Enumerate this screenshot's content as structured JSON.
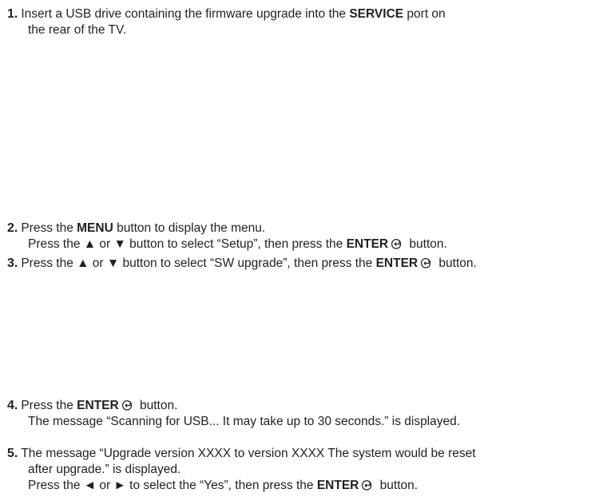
{
  "steps": [
    {
      "number": "1.",
      "line1_a": "Insert a USB drive containing the firmware upgrade into the ",
      "line1_bold": "SERVICE",
      "line1_b": " port on",
      "line2": "the rear of the TV."
    },
    {
      "number": "2.",
      "line1_a": "Press the ",
      "line1_bold": "MENU",
      "line1_b": " button to display the menu.",
      "line2_a": "Press the ▲ or ▼ button to select “Setup”, then press the ",
      "line2_bold": "ENTER",
      "line2_b": " button."
    },
    {
      "number": "3.",
      "line1_a": "Press the ▲ or ▼ button to select “SW upgrade”, then press the ",
      "line1_bold": "ENTER",
      "line1_b": " button."
    },
    {
      "number": "4.",
      "line1_a": "Press the ",
      "line1_bold": "ENTER",
      "line1_b": " button.",
      "line2": "The message “Scanning for USB... It may take up to 30 seconds.” is displayed."
    },
    {
      "number": "5.",
      "line1": "The message “Upgrade version XXXX to version XXXX The system would be reset",
      "line2": "after upgrade.” is displayed.",
      "line3_a": "Press the ◄ or ► to select the “Yes”, then press the ",
      "line3_bold": "ENTER",
      "line3_b": " button."
    }
  ],
  "icons": {
    "enter": "enter-icon"
  }
}
